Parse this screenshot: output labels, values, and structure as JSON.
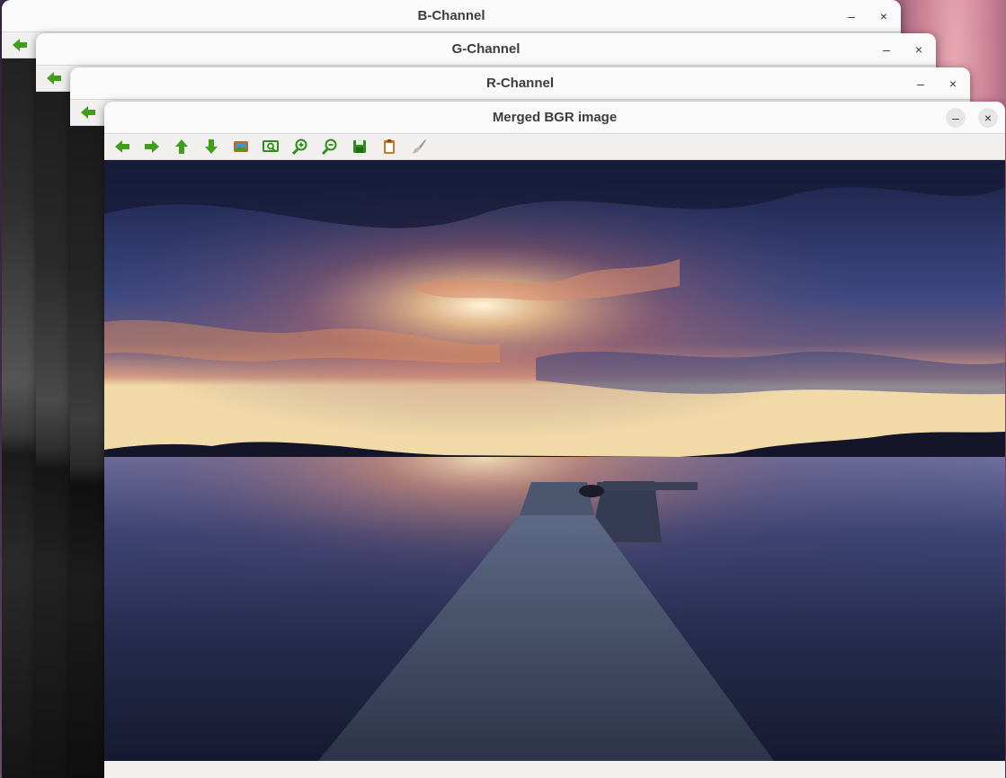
{
  "windows": [
    {
      "id": "b",
      "title": "B-Channel"
    },
    {
      "id": "g",
      "title": "G-Channel"
    },
    {
      "id": "r",
      "title": "R-Channel"
    },
    {
      "id": "merged",
      "title": "Merged BGR image"
    }
  ],
  "controls": {
    "minimize": "–",
    "close": "×"
  },
  "toolbar": [
    {
      "name": "back-arrow-icon",
      "color": "#3f9e1b"
    },
    {
      "name": "forward-arrow-icon",
      "color": "#3f9e1b"
    },
    {
      "name": "up-arrow-icon",
      "color": "#3f9e1b"
    },
    {
      "name": "down-arrow-icon",
      "color": "#3f9e1b"
    },
    {
      "name": "image-icon",
      "color": "#c9761f"
    },
    {
      "name": "zoom-fit-icon",
      "color": "#2e8c1a"
    },
    {
      "name": "zoom-in-icon",
      "color": "#2e8c1a"
    },
    {
      "name": "zoom-out-icon",
      "color": "#2e8c1a"
    },
    {
      "name": "save-icon",
      "color": "#2e8c1a"
    },
    {
      "name": "clipboard-icon",
      "color": "#c9761f"
    },
    {
      "name": "brush-icon",
      "color": "#8a8a8a"
    }
  ]
}
